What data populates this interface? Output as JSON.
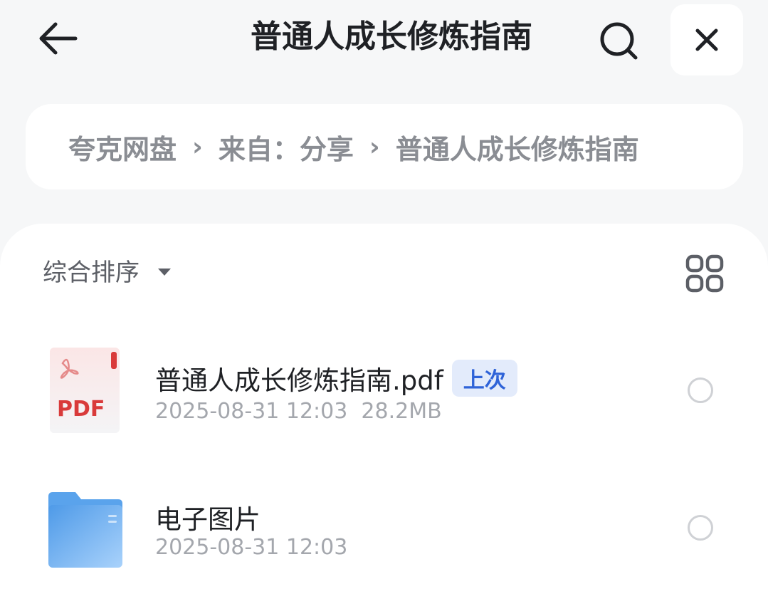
{
  "header": {
    "title": "普通人成长修炼指南",
    "icons": {
      "back": "arrow-left-icon",
      "search": "search-icon",
      "close": "close-icon"
    }
  },
  "breadcrumb": {
    "items": [
      "夸克网盘",
      "来自：分享",
      "普通人成长修炼指南"
    ],
    "separator": "›"
  },
  "toolbar": {
    "sort_label": "综合排序",
    "view_icon": "grid-view-icon"
  },
  "files": [
    {
      "name": "普通人成长修炼指南.pdf",
      "badge": "上次",
      "meta": "2025-08-31 12:03  28.2MB",
      "icon": "pdf-file-icon",
      "icon_text": "PDF"
    },
    {
      "name": "电子图片",
      "meta": "2025-08-31 12:03",
      "icon": "folder-icon"
    }
  ],
  "colors": {
    "background": "#f6f7f8",
    "badge_bg": "#e3ebfb",
    "badge_text": "#2f63d8",
    "pdf_red": "#d93a3a",
    "folder_blue": "#6aafef"
  }
}
